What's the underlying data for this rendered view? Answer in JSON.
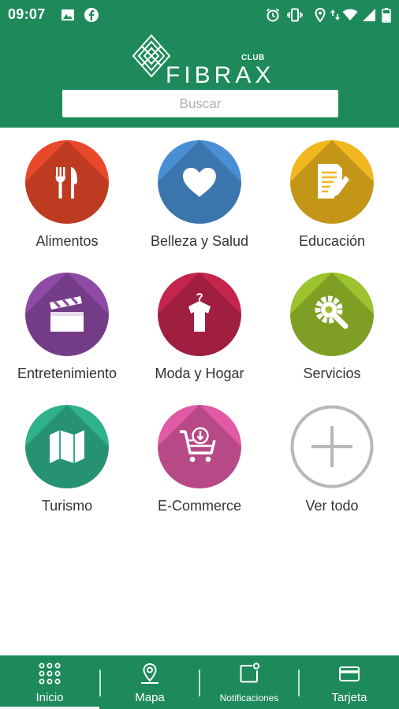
{
  "status": {
    "time": "09:07",
    "icons_left": [
      "image-icon",
      "facebook-icon"
    ],
    "icons_right": [
      "alarm-icon",
      "vibrate-icon",
      "location-icon",
      "data-arrows-icon",
      "wifi-icon",
      "signal-icon",
      "battery-icon"
    ]
  },
  "header": {
    "brand": "FIBRAX",
    "brand_small": "CLUB",
    "search_placeholder": "Buscar"
  },
  "categories": [
    {
      "label": "Alimentos",
      "color": "#e8492a",
      "icon": "fork-knife-icon"
    },
    {
      "label": "Belleza y Salud",
      "color": "#4a8fd4",
      "icon": "heart-icon"
    },
    {
      "label": "Educación",
      "color": "#f0b81e",
      "icon": "document-pencil-icon"
    },
    {
      "label": "Entretenimiento",
      "color": "#8e4aa4",
      "icon": "clapperboard-icon"
    },
    {
      "label": "Moda y Hogar",
      "color": "#c4254d",
      "icon": "dress-hanger-icon"
    },
    {
      "label": "Servicios",
      "color": "#9cc22d",
      "icon": "gear-wrench-icon"
    },
    {
      "label": "Turismo",
      "color": "#2fb28c",
      "icon": "map-icon"
    },
    {
      "label": "E-Commerce",
      "color": "#e05aa4",
      "icon": "shopping-cart-icon"
    },
    {
      "label": "Ver todo",
      "color": "#ffffff",
      "icon": "plus-icon"
    }
  ],
  "nav": {
    "items": [
      {
        "label": "Inicio",
        "icon": "grid-dots-icon",
        "active": true
      },
      {
        "label": "Mapa",
        "icon": "map-pin-icon",
        "active": false
      },
      {
        "label": "Notificaciones",
        "icon": "notification-icon",
        "active": false
      },
      {
        "label": "Tarjeta",
        "icon": "credit-card-icon",
        "active": false
      }
    ]
  },
  "colors": {
    "brand_green": "#1e8a5c",
    "label_text": "#333333",
    "plus_gray": "#b8b8b8"
  }
}
